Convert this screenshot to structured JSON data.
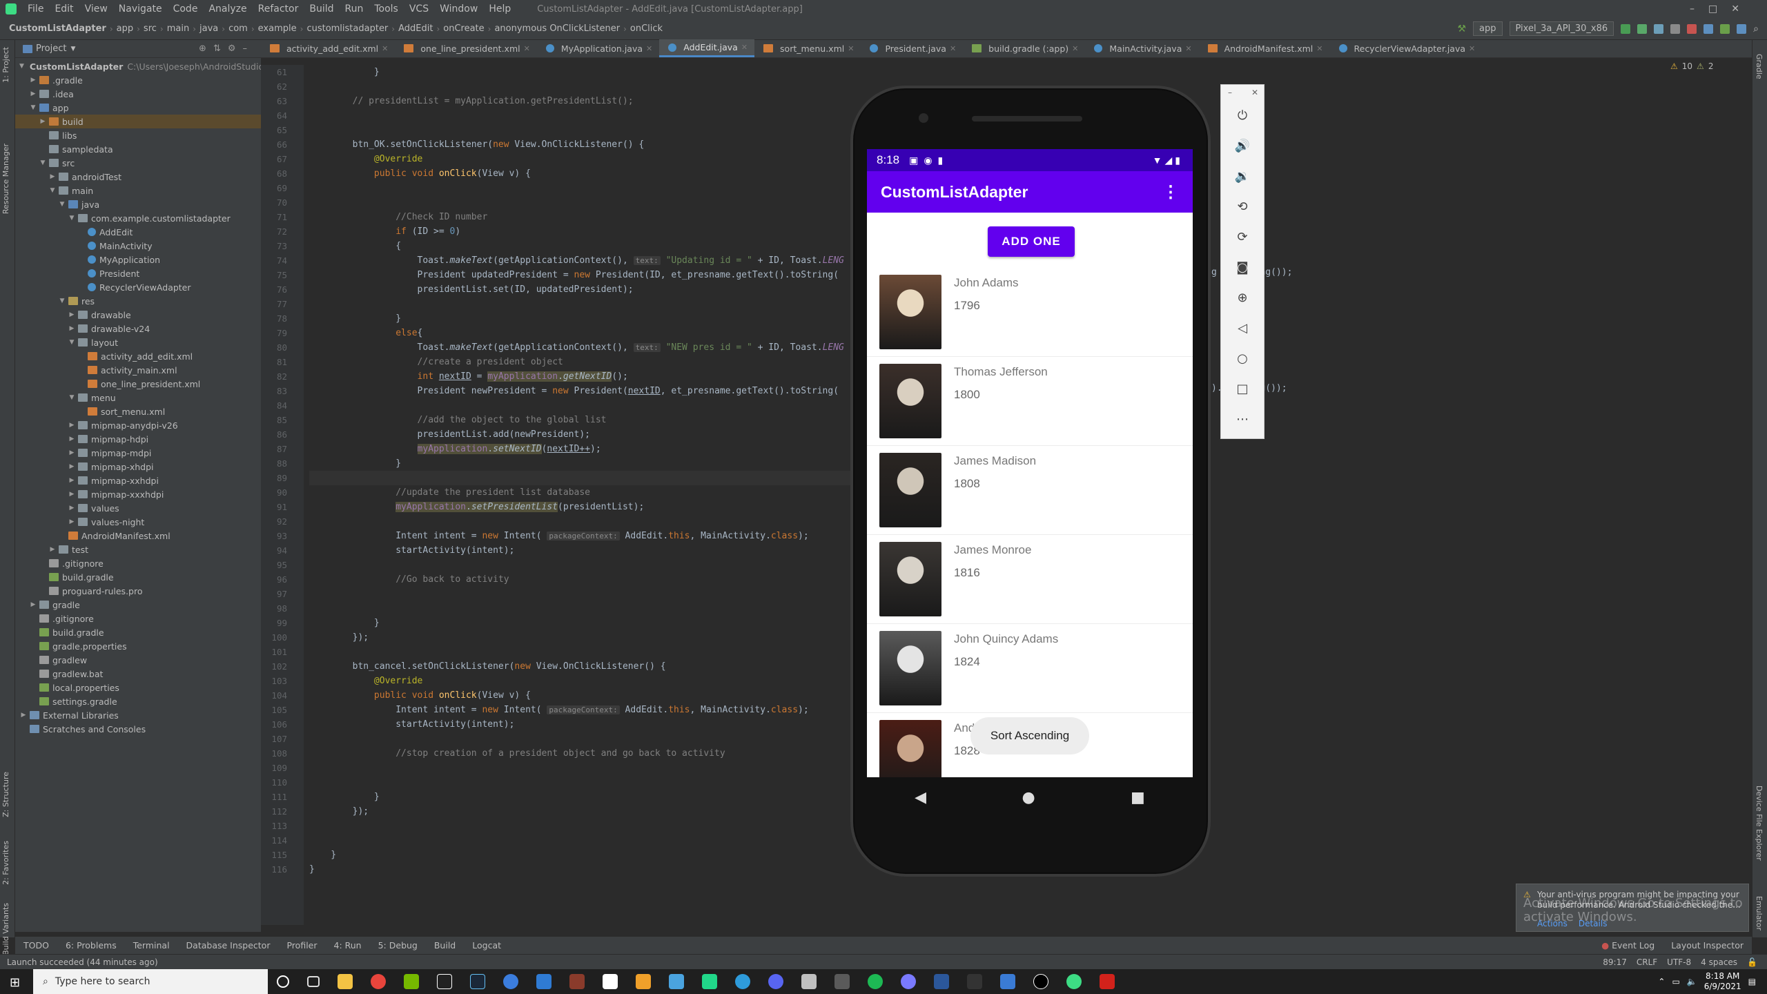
{
  "menu": {
    "items": [
      "File",
      "Edit",
      "View",
      "Navigate",
      "Code",
      "Analyze",
      "Refactor",
      "Build",
      "Run",
      "Tools",
      "VCS",
      "Window",
      "Help"
    ],
    "title": "CustomListAdapter - AddEdit.java [CustomListAdapter.app]"
  },
  "breadcrumb": [
    "CustomListAdapter",
    "app",
    "src",
    "main",
    "java",
    "com",
    "example",
    "customlistadapter",
    "AddEdit",
    "onCreate",
    "anonymous OnClickListener",
    "onClick"
  ],
  "toolbar": {
    "run_config": "app",
    "device": "Pixel_3a_API_30_x86"
  },
  "project_panel": {
    "header": "Project",
    "tree": [
      {
        "label": "CustomListAdapter",
        "extra": "C:\\Users\\Joeseph\\AndroidStudioProje",
        "depth": 0,
        "icon": "module-icon",
        "arrow": "down"
      },
      {
        "label": ".gradle",
        "depth": 1,
        "icon": "folder-icon-orange",
        "arrow": "right"
      },
      {
        "label": ".idea",
        "depth": 1,
        "icon": "folder-icon",
        "arrow": "right"
      },
      {
        "label": "app",
        "depth": 1,
        "icon": "module-icon",
        "arrow": "down"
      },
      {
        "label": "build",
        "depth": 2,
        "icon": "folder-icon-orange",
        "arrow": "right",
        "highlight": true
      },
      {
        "label": "libs",
        "depth": 2,
        "icon": "folder-icon",
        "arrow": ""
      },
      {
        "label": "sampledata",
        "depth": 2,
        "icon": "folder-icon",
        "arrow": ""
      },
      {
        "label": "src",
        "depth": 2,
        "icon": "folder-icon",
        "arrow": "down"
      },
      {
        "label": "androidTest",
        "depth": 3,
        "icon": "folder-icon",
        "arrow": "right"
      },
      {
        "label": "main",
        "depth": 3,
        "icon": "folder-icon",
        "arrow": "down"
      },
      {
        "label": "java",
        "depth": 4,
        "icon": "folder-icon-src",
        "arrow": "down"
      },
      {
        "label": "com.example.customlistadapter",
        "depth": 5,
        "icon": "folder-icon",
        "arrow": "down"
      },
      {
        "label": "AddEdit",
        "depth": 6,
        "icon": "class-icon",
        "arrow": ""
      },
      {
        "label": "MainActivity",
        "depth": 6,
        "icon": "class-icon",
        "arrow": ""
      },
      {
        "label": "MyApplication",
        "depth": 6,
        "icon": "class-icon",
        "arrow": ""
      },
      {
        "label": "President",
        "depth": 6,
        "icon": "class-icon",
        "arrow": ""
      },
      {
        "label": "RecyclerViewAdapter",
        "depth": 6,
        "icon": "class-icon",
        "arrow": ""
      },
      {
        "label": "res",
        "depth": 4,
        "icon": "folder-icon-res",
        "arrow": "down"
      },
      {
        "label": "drawable",
        "depth": 5,
        "icon": "folder-icon",
        "arrow": "right"
      },
      {
        "label": "drawable-v24",
        "depth": 5,
        "icon": "folder-icon",
        "arrow": "right"
      },
      {
        "label": "layout",
        "depth": 5,
        "icon": "folder-icon",
        "arrow": "down"
      },
      {
        "label": "activity_add_edit.xml",
        "depth": 6,
        "icon": "xml-icon",
        "arrow": ""
      },
      {
        "label": "activity_main.xml",
        "depth": 6,
        "icon": "xml-icon",
        "arrow": ""
      },
      {
        "label": "one_line_president.xml",
        "depth": 6,
        "icon": "xml-icon",
        "arrow": ""
      },
      {
        "label": "menu",
        "depth": 5,
        "icon": "folder-icon",
        "arrow": "down"
      },
      {
        "label": "sort_menu.xml",
        "depth": 6,
        "icon": "xml-icon",
        "arrow": ""
      },
      {
        "label": "mipmap-anydpi-v26",
        "depth": 5,
        "icon": "folder-icon",
        "arrow": "right"
      },
      {
        "label": "mipmap-hdpi",
        "depth": 5,
        "icon": "folder-icon",
        "arrow": "right"
      },
      {
        "label": "mipmap-mdpi",
        "depth": 5,
        "icon": "folder-icon",
        "arrow": "right"
      },
      {
        "label": "mipmap-xhdpi",
        "depth": 5,
        "icon": "folder-icon",
        "arrow": "right"
      },
      {
        "label": "mipmap-xxhdpi",
        "depth": 5,
        "icon": "folder-icon",
        "arrow": "right"
      },
      {
        "label": "mipmap-xxxhdpi",
        "depth": 5,
        "icon": "folder-icon",
        "arrow": "right"
      },
      {
        "label": "values",
        "depth": 5,
        "icon": "folder-icon",
        "arrow": "right"
      },
      {
        "label": "values-night",
        "depth": 5,
        "icon": "folder-icon",
        "arrow": "right"
      },
      {
        "label": "AndroidManifest.xml",
        "depth": 4,
        "icon": "xml-icon",
        "arrow": ""
      },
      {
        "label": "test",
        "depth": 3,
        "icon": "folder-icon",
        "arrow": "right"
      },
      {
        "label": ".gitignore",
        "depth": 2,
        "icon": "file-icon",
        "arrow": ""
      },
      {
        "label": "build.gradle",
        "depth": 2,
        "icon": "gradle-icon",
        "arrow": ""
      },
      {
        "label": "proguard-rules.pro",
        "depth": 2,
        "icon": "file-icon",
        "arrow": ""
      },
      {
        "label": "gradle",
        "depth": 1,
        "icon": "folder-icon",
        "arrow": "right"
      },
      {
        "label": ".gitignore",
        "depth": 1,
        "icon": "file-icon",
        "arrow": ""
      },
      {
        "label": "build.gradle",
        "depth": 1,
        "icon": "gradle-icon",
        "arrow": ""
      },
      {
        "label": "gradle.properties",
        "depth": 1,
        "icon": "gradle-icon",
        "arrow": ""
      },
      {
        "label": "gradlew",
        "depth": 1,
        "icon": "file-icon",
        "arrow": ""
      },
      {
        "label": "gradlew.bat",
        "depth": 1,
        "icon": "file-icon",
        "arrow": ""
      },
      {
        "label": "local.properties",
        "depth": 1,
        "icon": "gradle-icon",
        "arrow": ""
      },
      {
        "label": "settings.gradle",
        "depth": 1,
        "icon": "gradle-icon",
        "arrow": ""
      },
      {
        "label": "External Libraries",
        "depth": 0,
        "icon": "library-icon",
        "arrow": "right"
      },
      {
        "label": "Scratches and Consoles",
        "depth": 0,
        "icon": "library-icon",
        "arrow": ""
      }
    ]
  },
  "editor_tabs": [
    {
      "label": "activity_add_edit.xml",
      "active": false
    },
    {
      "label": "one_line_president.xml",
      "active": false
    },
    {
      "label": "MyApplication.java",
      "active": false
    },
    {
      "label": "AddEdit.java",
      "active": true
    },
    {
      "label": "sort_menu.xml",
      "active": false
    },
    {
      "label": "President.java",
      "active": false
    },
    {
      "label": "build.gradle (:app)",
      "active": false
    },
    {
      "label": "MainActivity.java",
      "active": false
    },
    {
      "label": "AndroidManifest.xml",
      "active": false
    },
    {
      "label": "RecyclerViewAdapter.java",
      "active": false
    }
  ],
  "inspections": {
    "warnings": "10",
    "weak_warnings": "2"
  },
  "code_lines": [
    {
      "n": "61",
      "html": "            }"
    },
    {
      "n": "62",
      "html": ""
    },
    {
      "n": "63",
      "html": "        <span class='cm'>// presidentList = myApplication.getPresidentList();</span>"
    },
    {
      "n": "64",
      "html": ""
    },
    {
      "n": "65",
      "html": ""
    },
    {
      "n": "66",
      "html": "        btn_OK.setOnClickListener(<span class='kw'>new</span> View.OnClickListener() {"
    },
    {
      "n": "67",
      "html": "            <span class='an'>@Override</span>"
    },
    {
      "n": "68",
      "html": "            <span class='kw'>public void</span> <span class='fn'>onClick</span>(View v) {"
    },
    {
      "n": "69",
      "html": ""
    },
    {
      "n": "70",
      "html": ""
    },
    {
      "n": "71",
      "html": "                <span class='cm'>//Check ID number</span>"
    },
    {
      "n": "72",
      "html": "                <span class='kw'>if</span> (ID &gt;= <span class='num'>0</span>)"
    },
    {
      "n": "73",
      "html": "                {"
    },
    {
      "n": "74",
      "html": "                    Toast.<span class='it'>makeText</span>(getApplicationContext(), <span class='hint'>text:</span> <span class='st'>\"Updating id = \"</span> + ID, Toast.<span class='it' style='color:#9876aa'>LENG</span>"
    },
    {
      "n": "75",
      "html": "                    President updatedPresident = <span class='kw'>new</span> President(ID, et_presname.getText().toString("
    },
    {
      "n": "76",
      "html": "                    presidentList.set(ID, updatedPresident);"
    },
    {
      "n": "77",
      "html": ""
    },
    {
      "n": "78",
      "html": "                }"
    },
    {
      "n": "79",
      "html": "                <span class='kw'>else</span>{"
    },
    {
      "n": "80",
      "html": "                    Toast.<span class='it'>makeText</span>(getApplicationContext(), <span class='hint'>text:</span> <span class='st'>\"NEW pres id = \"</span> + ID, Toast.<span class='it' style='color:#9876aa'>LENG</span>"
    },
    {
      "n": "81",
      "html": "                    <span class='cm'>//create a president object</span>"
    },
    {
      "n": "82",
      "html": "                    <span class='kw'>int</span> <u>nextID</u> = <span class='hl'><span style='color:#9876aa'>myApplication</span>.<span class='it'>getNextID</span></span>();"
    },
    {
      "n": "83",
      "html": "                    President newPresident = <span class='kw'>new</span> President(<u>nextID</u>, et_presname.getText().toString("
    },
    {
      "n": "84",
      "html": ""
    },
    {
      "n": "85",
      "html": "                    <span class='cm'>//add the object to the global list</span>"
    },
    {
      "n": "86",
      "html": "                    presidentList.add(newPresident);"
    },
    {
      "n": "87",
      "html": "                    <span class='hl'><span style='color:#9876aa'>myApplication</span>.<span class='it'>setNextID</span></span>(<u>nextID++</u>);"
    },
    {
      "n": "88",
      "html": "                }"
    },
    {
      "n": "89",
      "html": ""
    },
    {
      "n": "90",
      "html": "                <span class='cm'>//update the president list database</span>"
    },
    {
      "n": "91",
      "html": "                <span class='hl'><span style='color:#9876aa'>myApplication</span>.<span class='it'>setPresidentList</span></span>(presidentList);"
    },
    {
      "n": "92",
      "html": ""
    },
    {
      "n": "93",
      "html": "                Intent intent = <span class='kw'>new</span> Intent( <span class='hint'>packageContext:</span> AddEdit.<span class='kw'>this</span>, MainActivity.<span class='kw'>class</span>);"
    },
    {
      "n": "94",
      "html": "                startActivity(intent);"
    },
    {
      "n": "95",
      "html": ""
    },
    {
      "n": "96",
      "html": "                <span class='cm'>//Go back to activity</span>"
    },
    {
      "n": "97",
      "html": ""
    },
    {
      "n": "98",
      "html": ""
    },
    {
      "n": "99",
      "html": "            }"
    },
    {
      "n": "100",
      "html": "        });"
    },
    {
      "n": "101",
      "html": ""
    },
    {
      "n": "102",
      "html": "        btn_cancel.setOnClickListener(<span class='kw'>new</span> View.OnClickListener() {"
    },
    {
      "n": "103",
      "html": "            <span class='an'>@Override</span>"
    },
    {
      "n": "104",
      "html": "            <span class='kw'>public void</span> <span class='fn'>onClick</span>(View v) {"
    },
    {
      "n": "105",
      "html": "                Intent intent = <span class='kw'>new</span> Intent( <span class='hint'>packageContext:</span> AddEdit.<span class='kw'>this</span>, MainActivity.<span class='kw'>class</span>);"
    },
    {
      "n": "106",
      "html": "                startActivity(intent);"
    },
    {
      "n": "107",
      "html": ""
    },
    {
      "n": "108",
      "html": "                <span class='cm'>//stop creation of a president object and go back to activity</span>"
    },
    {
      "n": "109",
      "html": ""
    },
    {
      "n": "110",
      "html": ""
    },
    {
      "n": "111",
      "html": "            }"
    },
    {
      "n": "112",
      "html": "        });"
    },
    {
      "n": "113",
      "html": ""
    },
    {
      "n": "114",
      "html": ""
    },
    {
      "n": "115",
      "html": "    }"
    },
    {
      "n": "116",
      "html": "}"
    }
  ],
  "code_right_fragments": [
    "g",
    ".toString());",
    ").toString());"
  ],
  "emulator": {
    "status_time": "8:18",
    "app_title": "CustomListAdapter",
    "add_button": "ADD ONE",
    "presidents": [
      {
        "name": "John Adams",
        "year": "1796"
      },
      {
        "name": "Thomas Jefferson",
        "year": "1800"
      },
      {
        "name": "James Madison",
        "year": "1808"
      },
      {
        "name": "James Monroe",
        "year": "1816"
      },
      {
        "name": "John Quincy Adams",
        "year": "1824"
      },
      {
        "name": "Andrew Jackson",
        "year": "1828"
      }
    ],
    "toast": "Sort Ascending"
  },
  "bottom_tools": [
    "TODO",
    "6: Problems",
    "Terminal",
    "Database Inspector",
    "Profiler",
    "4: Run",
    "5: Debug",
    "Build",
    "Logcat"
  ],
  "bottom_right_tools": [
    "Event Log",
    "Layout Inspector"
  ],
  "status": {
    "message": "Launch succeeded (44 minutes ago)",
    "position": "89:17",
    "line_sep": "CRLF",
    "encoding": "UTF-8",
    "indent": "4 spaces"
  },
  "notification": {
    "text": "Your anti-virus program might be impacting your build performance. Android Studio checked the...",
    "overlay": "Activate Windows Go to Settings to activate Windows.",
    "actions": "Actions",
    "details": "Details"
  },
  "side_tabs": {
    "left": [
      "1: Project",
      "Resource Manager",
      "Z: Structure",
      "2: Favorites",
      "Build Variants"
    ],
    "right": [
      "Gradle",
      "Device File Explorer",
      "Emulator"
    ]
  },
  "taskbar": {
    "search_placeholder": "Type here to search",
    "time": "8:18 AM",
    "date": "6/9/2021"
  },
  "colors": {
    "accent": "#6200ee",
    "status_dark": "#3700b3",
    "ide_bg": "#2b2b2b",
    "panel": "#3c3f41"
  }
}
